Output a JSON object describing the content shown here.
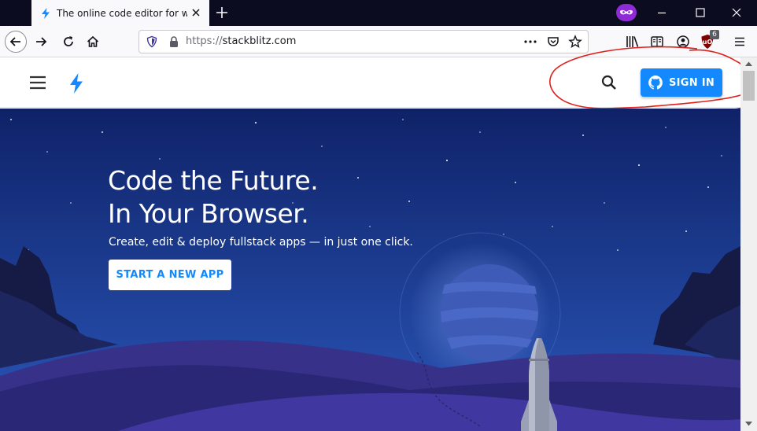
{
  "browser": {
    "tab_title": "The online code editor for web",
    "url_scheme": "https://",
    "url_host": "stackblitz.com",
    "extension_badge": "6"
  },
  "site": {
    "sign_in_label": "SIGN IN",
    "hero": {
      "headline_line1": "Code the Future.",
      "headline_line2": "In Your Browser.",
      "subtitle": "Create, edit & deploy fullstack apps — in just one click.",
      "cta_label": "START A NEW APP"
    }
  },
  "colors": {
    "brand_blue": "#1389fd",
    "hero_sky_top": "#0f2268",
    "hero_sky_bottom": "#2a56b8",
    "annotation_red": "#e0201c",
    "private_purple": "#8f2bd6"
  },
  "icons": [
    "stackblitz-bolt-icon",
    "close-icon",
    "plus-icon",
    "private-mask-icon",
    "minimize-icon",
    "maximize-icon",
    "window-close-icon",
    "back-arrow-icon",
    "forward-arrow-icon",
    "reload-icon",
    "home-icon",
    "tracking-shield-icon",
    "lock-icon",
    "more-dots-icon",
    "pocket-icon",
    "star-icon",
    "library-icon",
    "reader-icon",
    "account-icon",
    "ublock-icon",
    "hamburger-menu-icon",
    "search-icon",
    "github-icon"
  ]
}
